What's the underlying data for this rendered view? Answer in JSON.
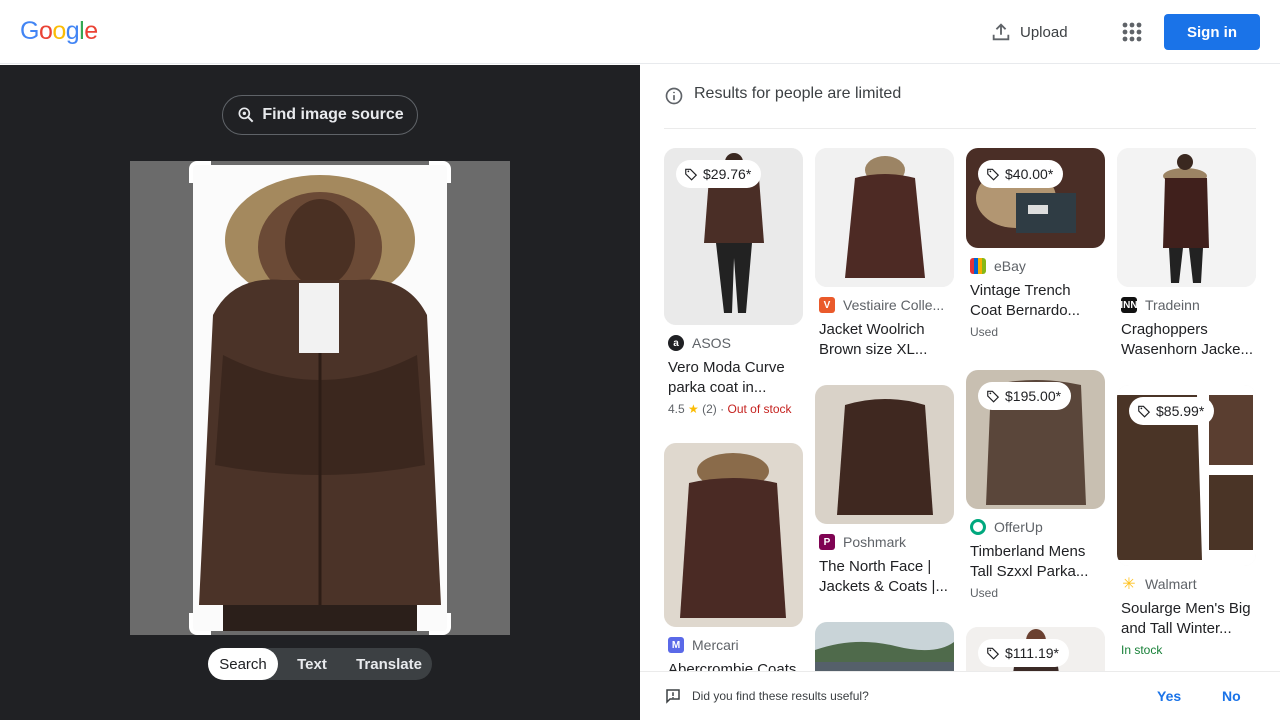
{
  "header": {
    "logo_letters": [
      "G",
      "o",
      "o",
      "g",
      "l",
      "e"
    ],
    "upload_label": "Upload",
    "signin_label": "Sign in",
    "upload_icon": "upload-icon",
    "apps_icon": "apps-grid-icon"
  },
  "left": {
    "find_source_label": "Find image source",
    "modes": [
      "Search",
      "Text",
      "Translate"
    ],
    "active_mode": "Search"
  },
  "right": {
    "notice": "Results for people are limited",
    "results": [
      {
        "price": "$29.76*",
        "source": "ASOS",
        "title": "Vero Moda Curve parka coat in...",
        "rating": "4.5",
        "reviews": "(2)",
        "stock": "Out of stock",
        "icon_color": "#202124"
      },
      {
        "price": "",
        "source": "Vestiaire Colle...",
        "title": "Jacket Woolrich Brown size XL...",
        "icon_color": "#ea5a2b"
      },
      {
        "price": "$40.00*",
        "source": "eBay",
        "title": "Vintage Trench Coat Bernardo...",
        "status": "Used",
        "icon_color": "#e53238"
      },
      {
        "price": "",
        "source": "Tradeinn",
        "title": "Craghoppers Wasenhorn Jacke...",
        "icon_color": "#111111"
      },
      {
        "price": "",
        "source": "Mercari",
        "title": "Abercrombie Coats &...",
        "icon_color": "#5a69e8"
      },
      {
        "price": "",
        "source": "Poshmark",
        "title": "The North Face | Jackets & Coats |...",
        "icon_color": "#7f0353"
      },
      {
        "price": "$195.00*",
        "source": "OfferUp",
        "title": "Timberland Mens Tall Szxxl Parka...",
        "status": "Used",
        "icon_color": "#00a87e"
      },
      {
        "price": "$85.99*",
        "source": "Walmart",
        "title": "Soularge Men's Big and Tall Winter...",
        "status": "In stock",
        "icon_color": "#ffc220"
      },
      {
        "price": "",
        "source": "",
        "title": "",
        "icon_color": "#999999"
      },
      {
        "price": "$111.19*",
        "source": "",
        "title": "",
        "icon_color": "#999999"
      }
    ]
  },
  "feedback": {
    "question": "Did you find these results useful?",
    "yes": "Yes",
    "no": "No"
  },
  "colors": {
    "accent": "#1a73e8",
    "dark_panel": "#202124",
    "out_of_stock": "#c5221f",
    "in_stock": "#188038"
  }
}
